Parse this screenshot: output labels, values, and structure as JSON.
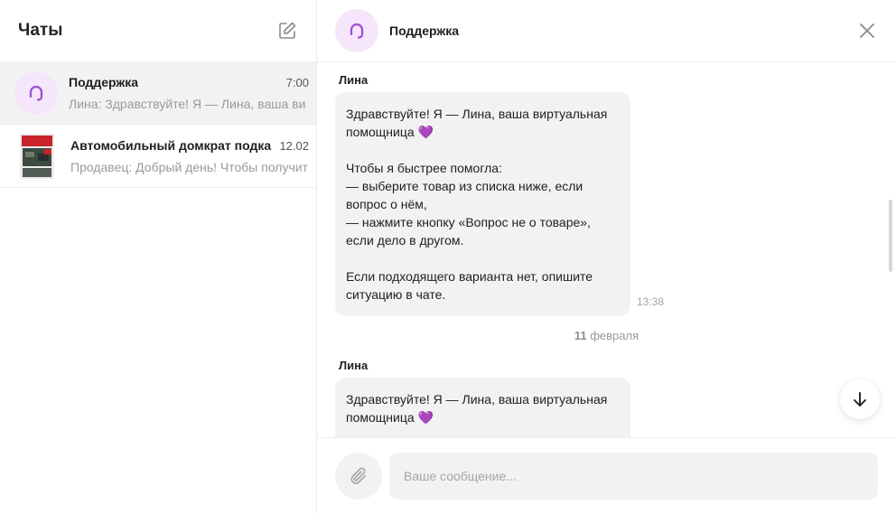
{
  "sidebar": {
    "title": "Чаты",
    "chats": [
      {
        "name": "Поддержка",
        "time": "7:00",
        "preview": "Лина: Здравствуйте! Я — Лина, ваша ви",
        "active": true
      },
      {
        "name": "Автомобильный домкрат подкат",
        "time": "12.02",
        "preview": "Продавец: Добрый день! Чтобы получит",
        "active": false
      }
    ]
  },
  "header": {
    "title": "Поддержка"
  },
  "messages": [
    {
      "sender": "Лина",
      "text": "Здравствуйте! Я — Лина, ваша виртуальная помощница 💜\n\nЧтобы я быстрее помогла:\n— выберите товар из списка ниже, если вопрос о нём,\n— нажмите кнопку «Вопрос не о товаре», если дело в другом.\n\nЕсли подходящего варианта нет, опишите ситуацию в чате.",
      "time": "13:38"
    },
    {
      "sender": "Лина",
      "text": "Здравствуйте! Я — Лина, ваша виртуальная помощница 💜"
    }
  ],
  "date_separator": {
    "day": "11",
    "month": "февраля"
  },
  "composer": {
    "placeholder": "Ваше сообщение..."
  },
  "colors": {
    "accent_purple": "#9b4fd0",
    "avatar_bg": "#f6e6fb",
    "bubble_bg": "#f2f2f3"
  },
  "icons": {
    "compose": "edit-icon",
    "support": "headset-icon",
    "close": "close-icon",
    "scroll": "arrow-down-icon",
    "attach": "paperclip-icon"
  }
}
